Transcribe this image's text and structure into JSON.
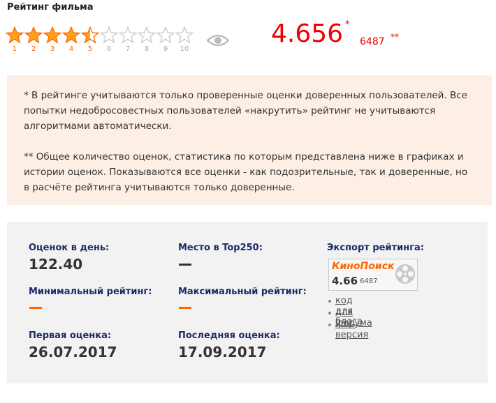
{
  "title": "Рейтинг фильма",
  "rating_widget": {
    "max_stars": 10,
    "filled_stars": 4.5,
    "numbers": [
      "1",
      "2",
      "3",
      "4",
      "5",
      "6",
      "7",
      "8",
      "9",
      "10"
    ],
    "eye_icon": "eye-icon"
  },
  "rating": {
    "value": "4.656",
    "value_mark": "*",
    "votes": "6487",
    "votes_mark": "**"
  },
  "note": {
    "p1": "* В рейтинге учитываются только проверенные оценки доверенных пользователей. Все попытки недобросовестных пользователей «накрутить» рейтинг не учитываются алгоритмами автоматически.",
    "p2": "** Общее количество оценок, статистика по которым представлена ниже в графиках и истории оценок. Показываются все оценки - как подозрительные, так и доверенные, но в расчёте рейтинга учитываются только доверенные."
  },
  "stats": {
    "per_day_label": "Оценок в день:",
    "per_day_value": "122.40",
    "top250_label": "Место в Top250:",
    "min_label": "Минимальный рейтинг:",
    "max_label": "Максимальный рейтинг:",
    "first_label": "Первая оценка:",
    "first_value": "26.07.2017",
    "last_label": "Последняя оценка:",
    "last_value": "17.09.2017"
  },
  "export": {
    "label": "Экспорт рейтинга:",
    "badge_brand": "КиноПоиск",
    "badge_rating": "4.66",
    "badge_votes": "6487",
    "links": [
      "код для блога",
      "для форума",
      "xml-версия"
    ]
  },
  "colors": {
    "accent": "#ff6600",
    "rating": "#ee0000",
    "label": "#1c2a66",
    "note_bg": "#fdeee6",
    "stats_bg": "#f2f2f2"
  }
}
